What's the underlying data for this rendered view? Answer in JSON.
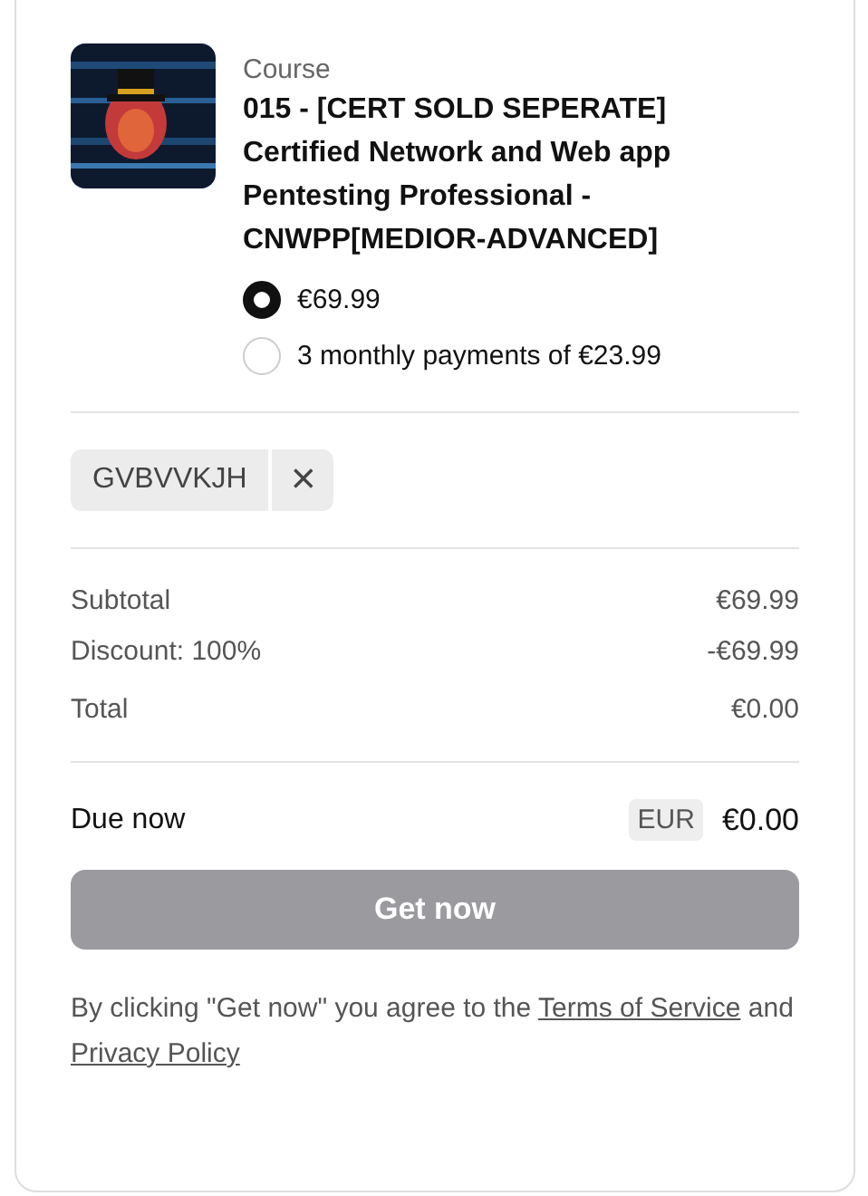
{
  "product": {
    "kind_label": "Course",
    "title": "015 - [CERT SOLD SEPERATE] Certified Network and Web app Pentesting Professional - CNWPP[MEDIOR-ADVANCED]"
  },
  "price_options": [
    {
      "label": "€69.99",
      "selected": true
    },
    {
      "label": "3 monthly payments of €23.99",
      "selected": false
    }
  ],
  "coupon": {
    "code": "GVBVVKJH",
    "remove": "×"
  },
  "summary": [
    {
      "label": "Subtotal",
      "value": "€69.99"
    },
    {
      "label": "Discount: 100%",
      "value": "-€69.99"
    },
    {
      "label": "Total",
      "value": "€0.00"
    }
  ],
  "due": {
    "label": "Due now",
    "currency": "EUR",
    "amount": "€0.00"
  },
  "button": {
    "label": "Get now",
    "disabled": true
  },
  "legal": {
    "text": "By clicking \"Get now\" you agree to the",
    "link1": "Terms of Service",
    "joiner": "and",
    "link2": "Privacy Policy"
  }
}
